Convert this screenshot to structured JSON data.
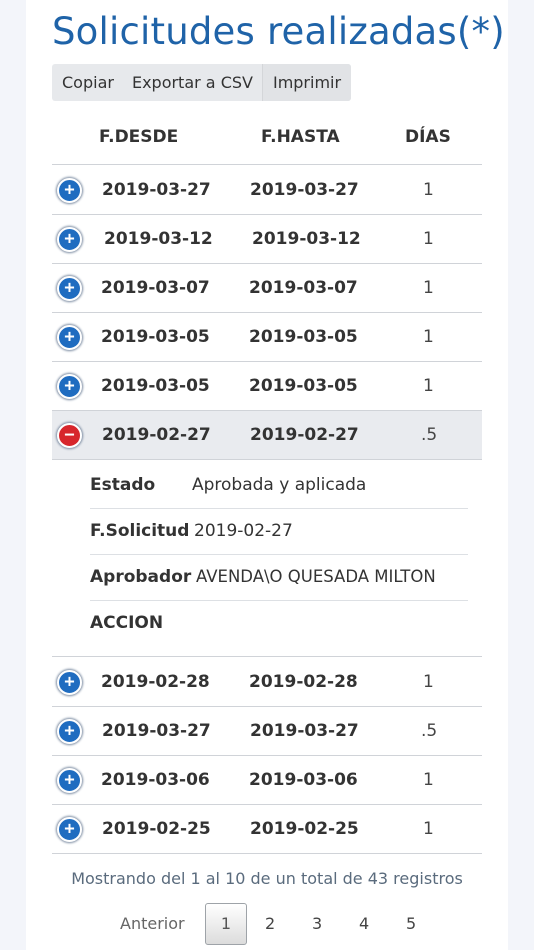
{
  "title": "Solicitudes realizadas(*)",
  "buttons": {
    "copy": "Copiar",
    "csv": "Exportar a CSV",
    "print": "Imprimir"
  },
  "columns": {
    "desde": "F.DESDE",
    "hasta": "F.HASTA",
    "dias": "DÍAS"
  },
  "rows": [
    {
      "desde": "2019-03-27",
      "hasta": "2019-03-27",
      "dias": "1"
    },
    {
      "desde": "2019-03-12",
      "hasta": "2019-03-12",
      "dias": "1"
    },
    {
      "desde": "2019-03-07",
      "hasta": "2019-03-07",
      "dias": "1"
    },
    {
      "desde": "2019-03-05",
      "hasta": "2019-03-05",
      "dias": "1"
    },
    {
      "desde": "2019-03-05",
      "hasta": "2019-03-05",
      "dias": "1"
    },
    {
      "desde": "2019-02-27",
      "hasta": "2019-02-27",
      "dias": ".5"
    },
    {
      "desde": "2019-02-28",
      "hasta": "2019-02-28",
      "dias": "1"
    },
    {
      "desde": "2019-03-27",
      "hasta": "2019-03-27",
      "dias": ".5"
    },
    {
      "desde": "2019-03-06",
      "hasta": "2019-03-06",
      "dias": "1"
    },
    {
      "desde": "2019-02-25",
      "hasta": "2019-02-25",
      "dias": "1"
    }
  ],
  "details": {
    "estado_label": "Estado",
    "estado_value": "Aprobada y aplicada",
    "fsol_label": "F.Solicitud",
    "fsol_value": "2019-02-27",
    "aprob_label": "Aprobador",
    "aprob_value": "AVENDA\\O QUESADA MILTON",
    "accion_label": "ACCION"
  },
  "info": "Mostrando del 1 al 10 de un total de 43 registros",
  "pagination": {
    "prev": "Anterior",
    "pages": [
      "1",
      "2",
      "3",
      "4",
      "5"
    ]
  },
  "colors": {
    "title": "#1f63a8",
    "expand": "#1f6cc0",
    "collapse": "#d7262c"
  },
  "icons": {
    "expand": "plus-circle-icon",
    "collapse": "minus-circle-icon"
  }
}
